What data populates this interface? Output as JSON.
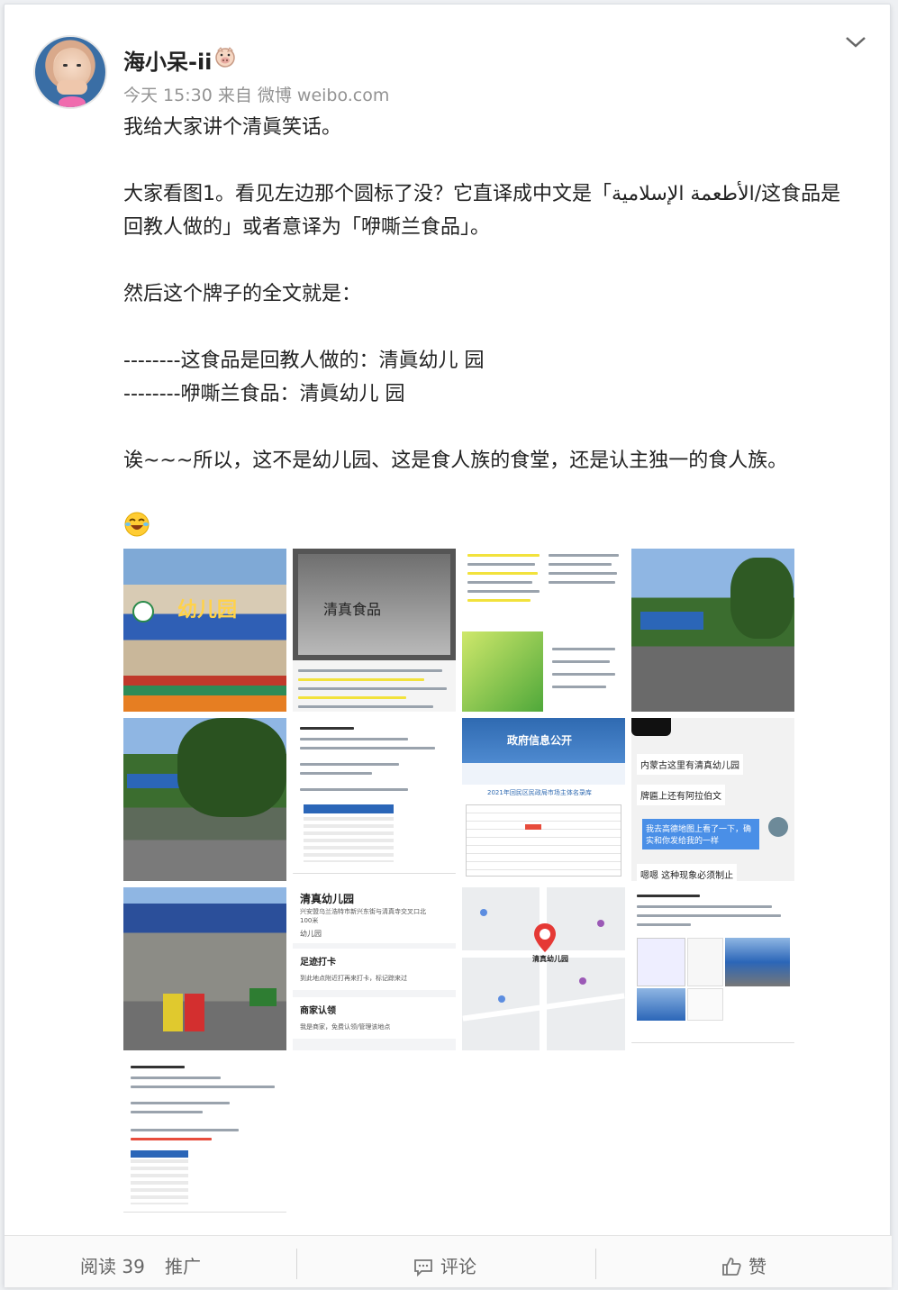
{
  "post": {
    "username": "海小呆-ii",
    "meta": "今天 15:30 来自 微博 weibo.com",
    "lines": [
      "我给大家讲个清眞笑话。",
      "",
      "大家看图1。看见左边那个圆标了没？它直译成中文是「الأطعمة الإسلامية/这食品是",
      "回教人做的」或者意译为「咿嘶兰食品」。",
      "",
      "然后这个牌子的全文就是：",
      "",
      "--------这食品是回教人做的：清眞幼儿 园",
      "--------咿嘶兰食品：清眞幼儿 园",
      "",
      "诶~~~所以，这不是幼儿园、这是食人族的食堂，还是认主独一的食人族。"
    ],
    "emoji_icon": "laughing-tears-emoji"
  },
  "images": {
    "sign_text": "幼儿园",
    "gov_title": "政府信息公开",
    "gov_subtitle": "2021年回民区民政局市场主体名录库",
    "chat_1": "内蒙古这里有清真幼儿园",
    "chat_2": "牌匾上还有阿拉伯文",
    "chat_3": "我去高德地图上看了一下，确实和你发给我的一样",
    "chat_4": "嗯嗯 这种现象必须制止",
    "map_card_title": "清真幼儿园",
    "map_card_addr": "兴安盟乌兰浩特市新兴东街与清真寺交叉口北100米",
    "map_card_type": "幼儿园",
    "map_card_checkin": "足迹打卡",
    "map_card_checkin_desc": "到此地点附近打再来打卡，标记踪来过",
    "map_card_merchant": "商家认领",
    "map_card_merchant_desc": "我是商家，免费认领/管理该地点",
    "map_pin_label": "清真幼儿园",
    "book_label": "清真食品"
  },
  "footer": {
    "read": "阅读 39",
    "promote": "推广",
    "comment": "评论",
    "like": "赞"
  }
}
